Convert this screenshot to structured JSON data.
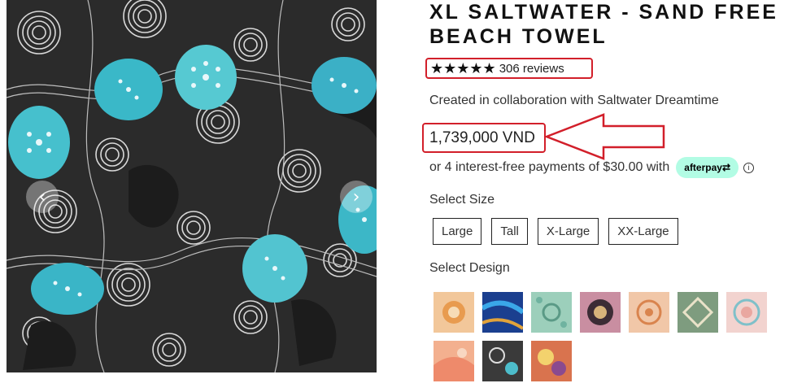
{
  "product": {
    "title": "XL SALTWATER - SAND FREE BEACH TOWEL",
    "stars": "★★★★★",
    "rating_value": 5,
    "reviews": "306 reviews",
    "collab": "Created in collaboration with Saltwater Dreamtime",
    "price": "1,739,000 VND",
    "installments": "or 4 interest-free payments of $30.00 with",
    "afterpay_label": "afterpay⇄",
    "info_glyph": "i"
  },
  "gallery": {
    "prev_glyph": "‹",
    "next_glyph": "›"
  },
  "size": {
    "label": "Select Size",
    "options": [
      "Large",
      "Tall",
      "X-Large",
      "XX-Large"
    ]
  },
  "design": {
    "label": "Select Design"
  },
  "colors": {
    "annotation_red": "#d21f2a",
    "afterpay_mint": "#b2fce4"
  }
}
